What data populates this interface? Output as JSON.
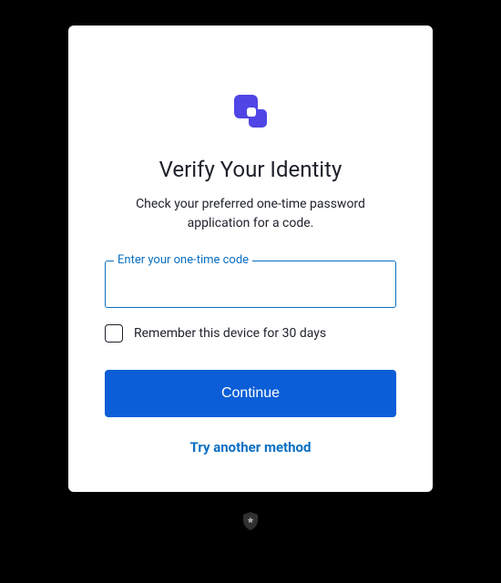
{
  "card": {
    "title": "Verify Your Identity",
    "subtitle": "Check your preferred one-time password application for a code.",
    "otp_label": "Enter your one-time code",
    "otp_value": "",
    "remember_label": "Remember this device for 30 days",
    "continue_label": "Continue",
    "try_another_label": "Try another method"
  },
  "colors": {
    "accent_blue": "#0a6fc2",
    "button_blue": "#0b5ed7",
    "logo_indigo": "#4f46e5"
  }
}
